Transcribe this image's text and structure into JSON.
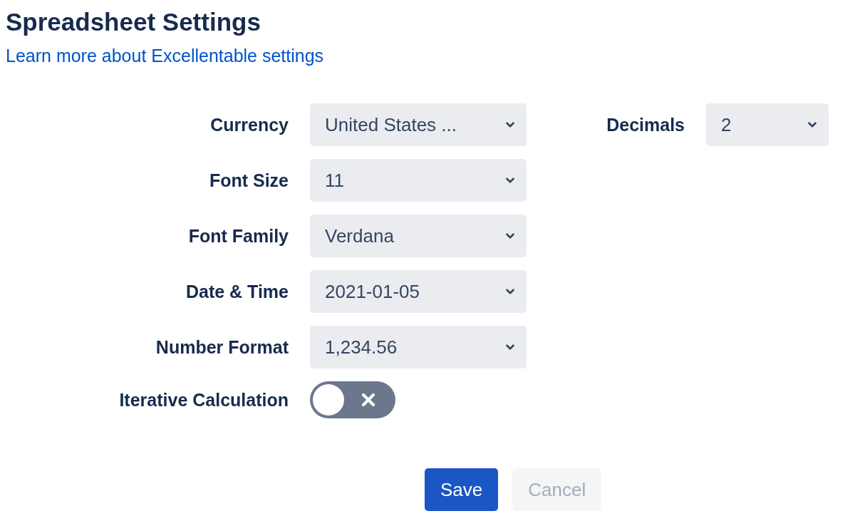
{
  "title": "Spreadsheet Settings",
  "help_link": "Learn more about Excellentable settings",
  "fields": [
    {
      "label": "Currency",
      "kind": "select",
      "value": "United States ..."
    },
    {
      "label": "Font Size",
      "kind": "select",
      "value": "11"
    },
    {
      "label": "Font Family",
      "kind": "select",
      "value": "Verdana"
    },
    {
      "label": "Date & Time",
      "kind": "select",
      "value": "2021-01-05"
    },
    {
      "label": "Number Format",
      "kind": "select",
      "value": "1,234.56"
    },
    {
      "label": "Iterative Calculation",
      "kind": "toggle",
      "on": false
    }
  ],
  "side_fields": [
    {
      "label": "Decimals",
      "kind": "select",
      "value": "2"
    }
  ],
  "buttons": [
    {
      "label": "Save",
      "kind": "primary",
      "disabled": false
    },
    {
      "label": "Cancel",
      "kind": "secondary",
      "disabled": true
    }
  ]
}
